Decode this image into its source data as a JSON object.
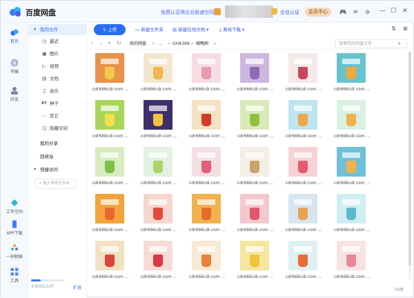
{
  "app": {
    "brand": "百度网盘",
    "promo": "免费认证得企业极速空间",
    "corp_cert": "企业认证",
    "member_center": "会员中心"
  },
  "titlebar": {
    "icons": {
      "game": "🎮",
      "mail": "✉",
      "settings": "⚙"
    },
    "min": "—",
    "max": "☐",
    "close": "✕"
  },
  "nav": [
    {
      "label": "首页",
      "icon": "cloud-icon",
      "active": true
    },
    {
      "label": "传输",
      "icon": "transfer-icon"
    },
    {
      "label": "好友",
      "icon": "friends-icon"
    },
    {
      "label": "工作空间",
      "icon": "workspace-icon"
    },
    {
      "label": "APP下载",
      "icon": "phone-icon"
    },
    {
      "label": "一刻相册",
      "icon": "album-icon"
    },
    {
      "label": "工具",
      "icon": "tools-icon"
    }
  ],
  "tree": {
    "my_files": "我的文件",
    "items": [
      {
        "glyph": "◷",
        "label": "最近"
      },
      {
        "glyph": "▣",
        "label": "图片"
      },
      {
        "glyph": "▷",
        "label": "视频"
      },
      {
        "glyph": "▤",
        "label": "文档"
      },
      {
        "glyph": "♫",
        "label": "音乐"
      },
      {
        "glyph": "BT",
        "label": "种子"
      },
      {
        "glyph": "⋯",
        "label": "其它"
      },
      {
        "glyph": "◫",
        "label": "隐藏空间"
      }
    ],
    "my_share": "我的分享",
    "recycle": "回收站",
    "quick": "快捷访问",
    "quick_placeholder": "+ 拖入常用文件夹",
    "storage": "4305G/14T",
    "expand": "扩容",
    "storage_fraction": 0.3
  },
  "toolbar": {
    "upload": "上传",
    "new_folder": "新建文件夹",
    "new_doc": "新建在线文档",
    "offline": "离线下载"
  },
  "path": {
    "crumbs": [
      "我的网盘",
      ">",
      "...",
      ">",
      "GHA369",
      ">",
      "缩略图",
      ">"
    ],
    "search_placeholder": "搜索我的网盘文件"
  },
  "files": [
    {
      "name": "cdr666cdr.com ...",
      "bg": "#e8924a",
      "cup": "#f2c94c"
    },
    {
      "name": "cdr666cdr.com ...",
      "bg": "#f2e6cf",
      "cup": "#f1b64e"
    },
    {
      "name": "cdr666cdr.com ...",
      "bg": "#f6dde3",
      "cup": "#e79ab0"
    },
    {
      "name": "cdr666cdr.com ...",
      "bg": "#cdb7e0",
      "cup": "#8e6bb7"
    },
    {
      "name": "cdr666cdr.com ...",
      "bg": "#f5e9ea",
      "cup": "#c7475b"
    },
    {
      "name": "cdr666cdr.com ...",
      "bg": "#69c3cc",
      "cup": "#f2a93b"
    },
    {
      "name": "cdr666cdr.com ...",
      "bg": "#a9d65a",
      "cup": "#f4e04d"
    },
    {
      "name": "cdr666cdr.com ...",
      "bg": "#3e2f6c",
      "cup": "#f1c33a"
    },
    {
      "name": "cdr666cdr.com ...",
      "bg": "#f4e2c3",
      "cup": "#d43b2e"
    },
    {
      "name": "cdr666cdr.com ...",
      "bg": "#dbe9b9",
      "cup": "#8fc23b"
    },
    {
      "name": "cdr666cdr.com ...",
      "bg": "#bde4ef",
      "cup": "#f0a64a"
    },
    {
      "name": "cdr666cdr.com ...",
      "bg": "#d9f0e2",
      "cup": "#f0b04a"
    },
    {
      "name": "cdr666cdr.com ...",
      "bg": "#d8ecc0",
      "cup": "#7cbf4a"
    },
    {
      "name": "cdr666cdr.com ...",
      "bg": "#e2f1e2",
      "cup": "#b0d26b"
    },
    {
      "name": "cdr666cdr.com ...",
      "bg": "#f4dfe5",
      "cup": "#e2607a"
    },
    {
      "name": "cdr666cdr.com ...",
      "bg": "#f3efe7",
      "cup": "#c9a270"
    },
    {
      "name": "cdr666cdr.com ...",
      "bg": "#f6d2d6",
      "cup": "#e25d6c"
    },
    {
      "name": "cdr666cdr.com ...",
      "bg": "#6fc0d8",
      "cup": "#f1b24a"
    },
    {
      "name": "cdr666cdr.com ...",
      "bg": "#f2a43a",
      "cup": "#e8672f"
    },
    {
      "name": "cdr666cdr.com ...",
      "bg": "#f5d7cf",
      "cup": "#e3493a"
    },
    {
      "name": "cdr666cdr.com ...",
      "bg": "#f2b24d",
      "cup": "#e66c2c"
    },
    {
      "name": "cdr666cdr.com ...",
      "bg": "#f2c9cd",
      "cup": "#e0566a"
    },
    {
      "name": "cdr666cdr.com ...",
      "bg": "#d6e5f0",
      "cup": "#e7a34d"
    },
    {
      "name": "cdr666cdr.com ...",
      "bg": "#cfeef1",
      "cup": "#5fb7cf"
    },
    {
      "name": "cdr666cdr.com ...",
      "bg": "#f2e2c2",
      "cup": "#d9453a"
    },
    {
      "name": "cdr666cdr.com ...",
      "bg": "#f6dcd5",
      "cup": "#d83a43"
    },
    {
      "name": "cdr666cdr.com ...",
      "bg": "#f8ead5",
      "cup": "#e7823a"
    },
    {
      "name": "cdr666cdr.com ...",
      "bg": "#f5e6a0",
      "cup": "#f0c33a"
    },
    {
      "name": "cdr666cdr.com ...",
      "bg": "#dff0f3",
      "cup": "#e56d3a"
    },
    {
      "name": "cdr666cdr.com ...",
      "bg": "#f8e3e3",
      "cup": "#e68a9a"
    }
  ],
  "item_count": "70项"
}
